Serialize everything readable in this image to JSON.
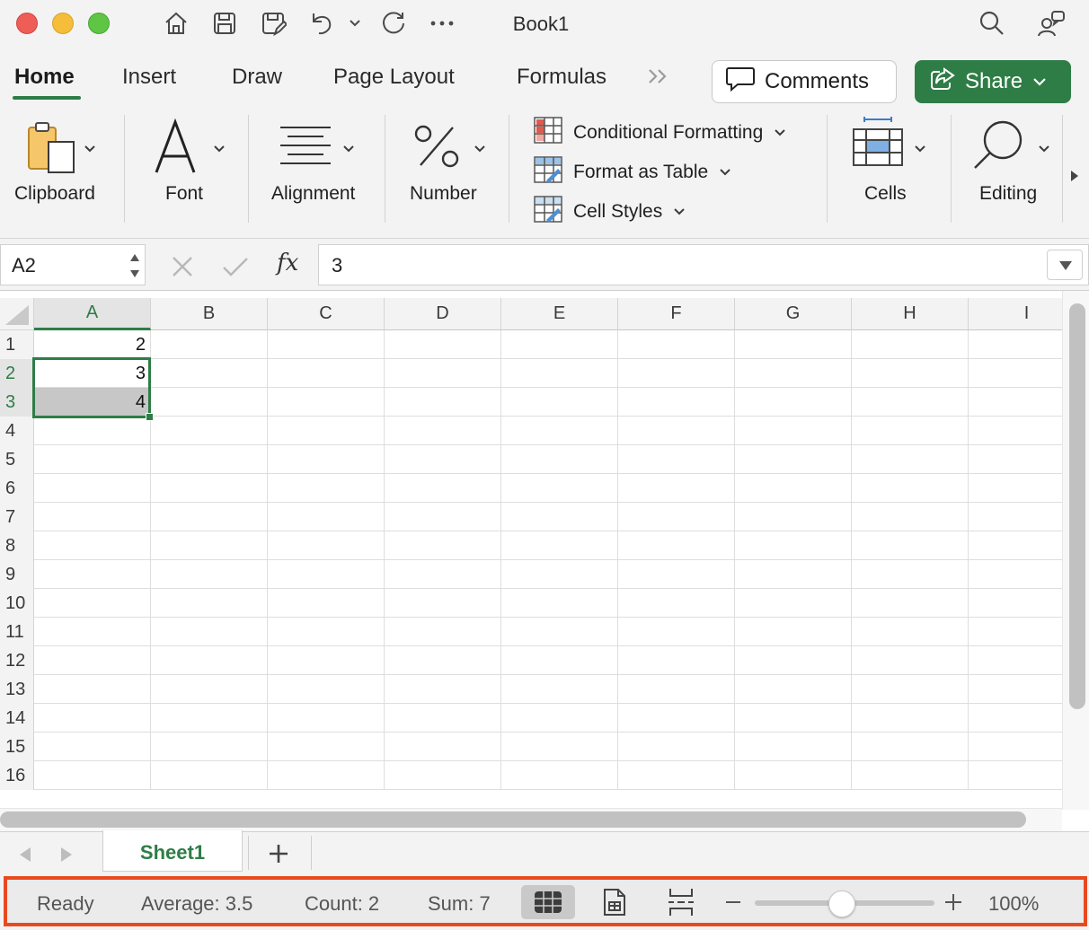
{
  "window": {
    "title": "Book1"
  },
  "ribbon_tabs": [
    {
      "label": "Home",
      "active": true
    },
    {
      "label": "Insert"
    },
    {
      "label": "Draw"
    },
    {
      "label": "Page Layout"
    },
    {
      "label": "Formulas"
    }
  ],
  "actions": {
    "comments_label": "Comments",
    "share_label": "Share"
  },
  "ribbon_groups": {
    "clipboard": "Clipboard",
    "font": "Font",
    "alignment": "Alignment",
    "number": "Number",
    "cells": "Cells",
    "editing": "Editing",
    "conditional_formatting": "Conditional Formatting",
    "format_as_table": "Format as Table",
    "cell_styles": "Cell Styles"
  },
  "formula_bar": {
    "name_box": "A2",
    "fx_label": "fx",
    "value": "3"
  },
  "columns": [
    "A",
    "B",
    "C",
    "D",
    "E",
    "F",
    "G",
    "H",
    "I"
  ],
  "rows": [
    "1",
    "2",
    "3",
    "4",
    "5",
    "6",
    "7",
    "8",
    "9",
    "10",
    "11",
    "12",
    "13",
    "14",
    "15",
    "16"
  ],
  "cells": {
    "A1": "2",
    "A2": "3",
    "A3": "4"
  },
  "sheets": [
    {
      "name": "Sheet1",
      "active": true
    }
  ],
  "status_bar": {
    "ready": "Ready",
    "average": "Average: 3.5",
    "count": "Count: 2",
    "sum": "Sum: 7",
    "zoom": "100%",
    "zoom_level": 1.0
  },
  "colors": {
    "accent_green": "#2e7d46",
    "highlight_border": "#e84a1f"
  }
}
